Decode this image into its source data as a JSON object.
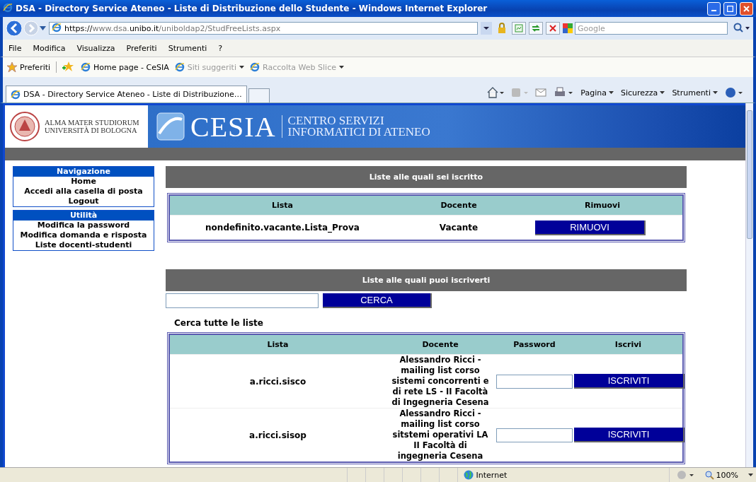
{
  "window": {
    "title": "DSA - Directory Service Ateneo - Liste di Distribuzione dello Studente - Windows Internet Explorer"
  },
  "address_bar": {
    "url_parts": [
      {
        "text": "https://",
        "dim": false
      },
      {
        "text": "www.dsa.",
        "dim": true
      },
      {
        "text": "unibo.it",
        "dim": false
      },
      {
        "text": "/uniboldap2/StudFreeLists.aspx",
        "dim": true
      }
    ]
  },
  "search_box": {
    "placeholder": "Google"
  },
  "menu": [
    "File",
    "Modifica",
    "Visualizza",
    "Preferiti",
    "Strumenti",
    "?"
  ],
  "favorites_bar": {
    "label": "Preferiti",
    "links": [
      {
        "label": "Home page - CeSIA",
        "disabled": false,
        "dropdown": false
      },
      {
        "label": "Siti suggeriti",
        "disabled": true,
        "dropdown": true
      },
      {
        "label": "Raccolta Web Slice",
        "disabled": true,
        "dropdown": true
      }
    ]
  },
  "tabs": [
    {
      "label": "DSA - Directory Service Ateneo - Liste di Distribuzione…",
      "selected": true
    }
  ],
  "command_bar": [
    "Pagina",
    "Sicurezza",
    "Strumenti"
  ],
  "header": {
    "university": [
      "ALMA MATER STUDIORUM",
      "UNIVERSITÀ DI BOLOGNA"
    ],
    "brand": "CESIA",
    "subtitle": [
      "CENTRO SERVIZI",
      "INFORMATICI DI ATENEO"
    ]
  },
  "sidebar": {
    "sections": [
      {
        "title": "Navigazione",
        "items": [
          "Home",
          "Accedi alla casella di posta",
          "Logout"
        ]
      },
      {
        "title": "Utilità",
        "items": [
          "Modifica la password",
          "Modifica domanda e risposta",
          "Liste docenti-studenti"
        ]
      }
    ]
  },
  "subscribed": {
    "title": "Liste alle quali sei iscritto",
    "columns": [
      "Lista",
      "Docente",
      "Rimuovi"
    ],
    "rows": [
      {
        "lista": "nondefinito.vacante.Lista_Prova",
        "docente": "Vacante",
        "button": "RIMUOVI"
      }
    ]
  },
  "available": {
    "title": "Liste alle quali puoi iscriverti",
    "search_button": "CERCA",
    "search_all_label": "Cerca tutte le liste",
    "columns": [
      "Lista",
      "Docente",
      "Password",
      "Iscrivi"
    ],
    "rows": [
      {
        "lista": "a.ricci.sisco",
        "docente": "Alessandro Ricci - mailing list corso sistemi concorrenti e di rete LS - II Facoltà di Ingegneria Cesena",
        "button": "ISCRIVITI"
      },
      {
        "lista": "a.ricci.sisop",
        "docente": "Alessandro Ricci - mailing list corso sitstemi operativi LA II Facoltà di ingegneria Cesena",
        "button": "ISCRIVITI"
      }
    ]
  },
  "status_bar": {
    "zone": "Internet",
    "zoom": "100%"
  }
}
